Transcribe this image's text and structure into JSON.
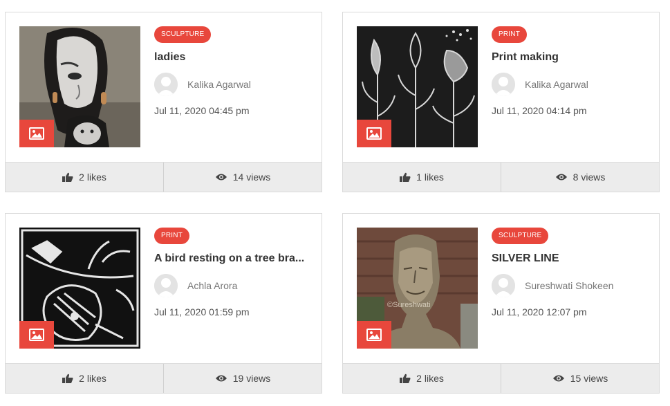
{
  "colors": {
    "accent": "#e8473c",
    "footer_bg": "#ececec"
  },
  "posts": [
    {
      "category": "SCULPTURE",
      "title": "ladies",
      "author": "Kalika Agarwal",
      "date": "Jul 11, 2020 04:45 pm",
      "likes": "2",
      "likes_label": "likes",
      "views": "14",
      "views_label": "views",
      "image_icon": "image-icon"
    },
    {
      "category": "PRINT",
      "title": "Print making",
      "author": "Kalika Agarwal",
      "date": "Jul 11, 2020 04:14 pm",
      "likes": "1",
      "likes_label": "likes",
      "views": "8",
      "views_label": "views",
      "image_icon": "image-icon"
    },
    {
      "category": "PRINT",
      "title": "A bird resting on a tree bra...",
      "author": "Achla Arora",
      "date": "Jul 11, 2020 01:59 pm",
      "likes": "2",
      "likes_label": "likes",
      "views": "19",
      "views_label": "views",
      "image_icon": "image-icon"
    },
    {
      "category": "SCULPTURE",
      "title": "SILVER LINE",
      "author": "Sureshwati Shokeen",
      "date": "Jul 11, 2020 12:07 pm",
      "likes": "2",
      "likes_label": "likes",
      "views": "15",
      "views_label": "views",
      "image_icon": "image-icon",
      "watermark": "©Sureshwati"
    }
  ]
}
